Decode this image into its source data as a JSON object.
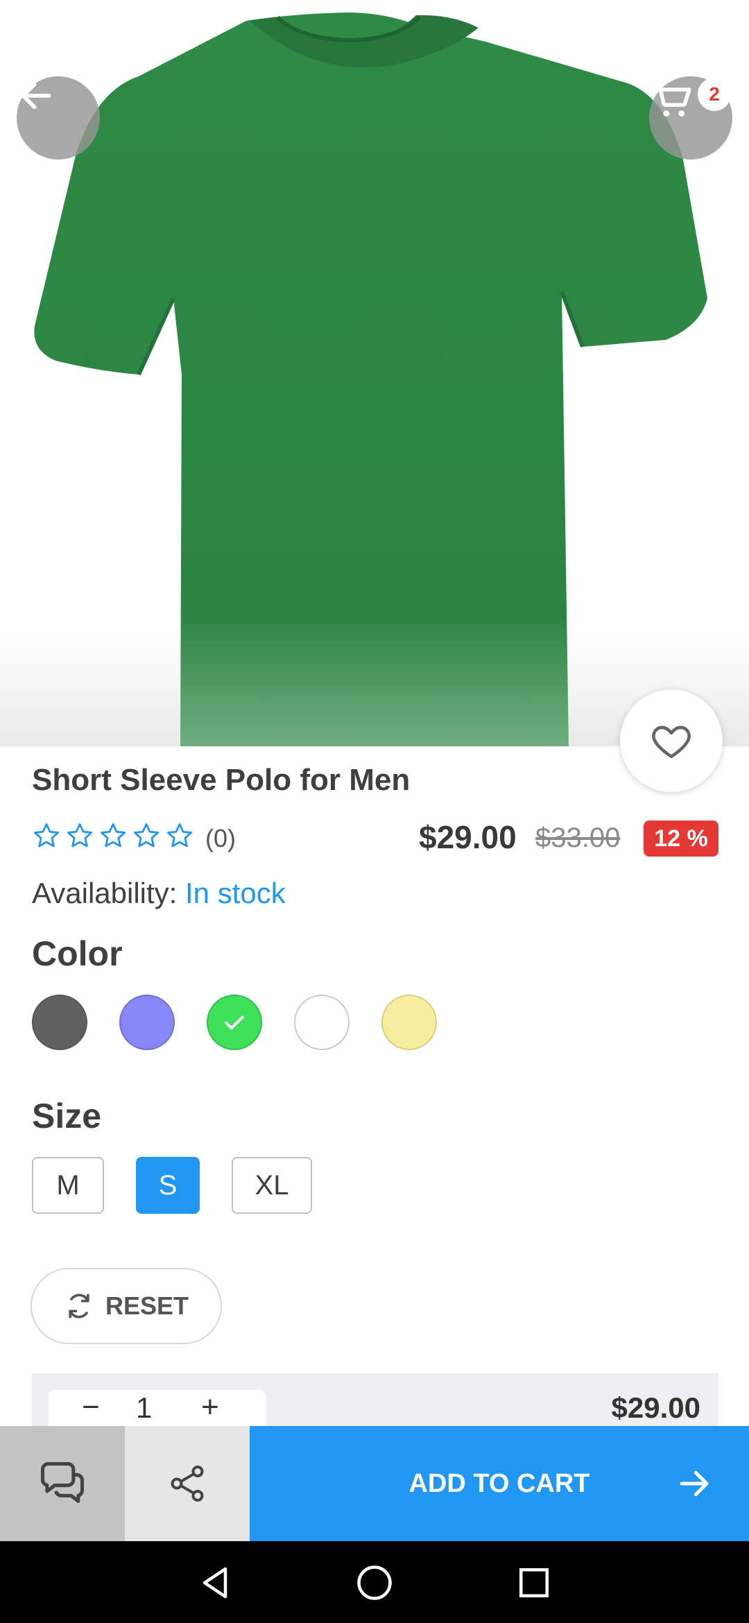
{
  "header": {
    "back_icon": "arrow-left-icon",
    "cart_icon": "cart-icon",
    "cart_count": "2"
  },
  "product": {
    "image_color": "#2f8a45",
    "title": "Short Sleeve Polo for Men",
    "rating_stars": 0,
    "rating_max": 5,
    "review_count": "(0)",
    "price": "$29.00",
    "old_price": "$33.00",
    "discount": "12 %",
    "availability_label": "Availability:",
    "availability_value": "In stock"
  },
  "colors": {
    "label": "Color",
    "options": [
      {
        "name": "dark-gray",
        "hex": "#616161",
        "selected": false
      },
      {
        "name": "periwinkle",
        "hex": "#8787f5",
        "selected": false
      },
      {
        "name": "green",
        "hex": "#3ee05a",
        "selected": true
      },
      {
        "name": "white",
        "hex": "#ffffff",
        "selected": false
      },
      {
        "name": "light-yellow",
        "hex": "#f6ee9f",
        "selected": false
      }
    ]
  },
  "sizes": {
    "label": "Size",
    "options": [
      "M",
      "S",
      "XL"
    ],
    "selected": "S"
  },
  "reset": {
    "label": "RESET"
  },
  "quantity": {
    "minus": "−",
    "value": "1",
    "plus": "+",
    "line_total": "$29.00"
  },
  "bottom_bar": {
    "chat_icon": "chat-icon",
    "share_icon": "share-icon",
    "add_to_cart_label": "ADD TO CART"
  },
  "theme": {
    "accent": "#2196f3",
    "sale": "#e53935"
  }
}
